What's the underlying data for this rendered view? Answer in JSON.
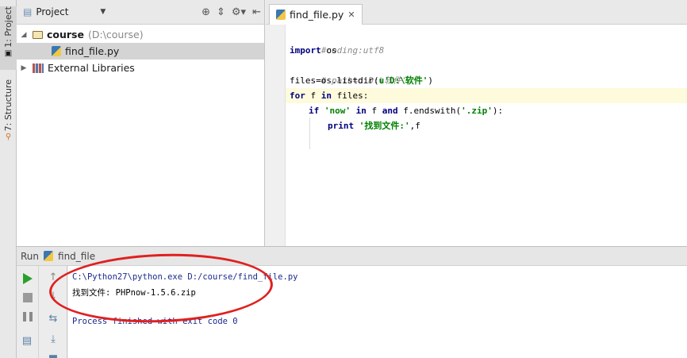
{
  "sidebar": {
    "tab_project": "1: Project",
    "tab_structure": "7: Structure"
  },
  "project_panel": {
    "selector_label": "Project",
    "tree": {
      "root_name": "course",
      "root_path": "(D:\\course)",
      "file": "find_file.py",
      "external": "External Libraries"
    }
  },
  "editor": {
    "tab_label": "find_file.py",
    "code": {
      "l1": "#coding:utf8",
      "l2_kw": "import",
      "l2_rest": " os",
      "l3": "# path=u'D:\\软件'",
      "l4_a": "files",
      "l4_b": "=os.listdir(",
      "l4_str": "u'D:\\软件'",
      "l4_c": ")",
      "l5_kw1": "for",
      "l5_a": " f ",
      "l5_kw2": "in",
      "l5_b": " files",
      "l5_c": ":",
      "l6_kw1": "if",
      "l6_str1": " 'now'",
      "l6_kw2": " in",
      "l6_a": " f ",
      "l6_kw3": "and",
      "l6_b": " f.endswith(",
      "l6_str2": "'.zip'",
      "l6_c": "):",
      "l7_kw": "print",
      "l7_str": " '找到文件:'",
      "l7_rest": ",f"
    }
  },
  "run_panel": {
    "label": "Run",
    "config": "find_file",
    "output": {
      "cmd": "C:\\Python27\\python.exe D:/course/find_file.py",
      "result": "找到文件: PHPnow-1.5.6.zip",
      "exit": "Process finished with exit code 0"
    }
  },
  "colors": {
    "annotation_ellipse": "#e02020",
    "keyword": "#000080",
    "string": "#008000"
  }
}
